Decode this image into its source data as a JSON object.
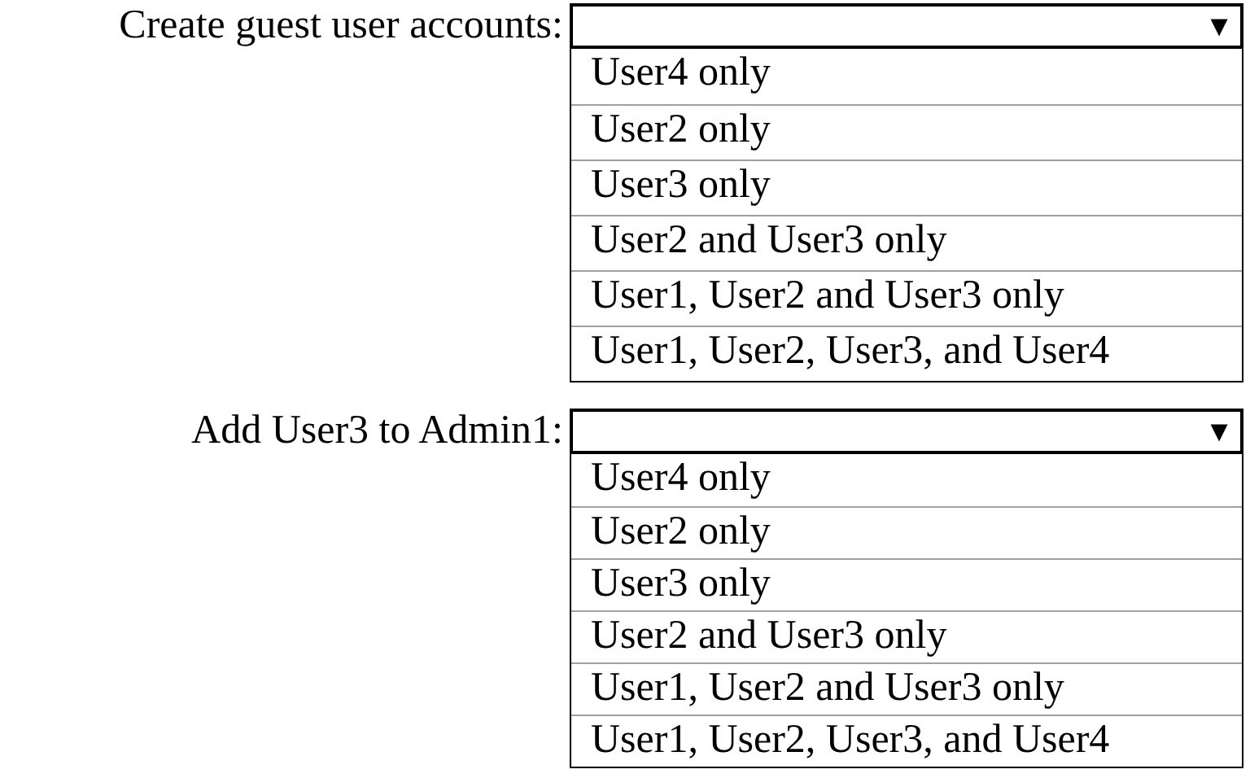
{
  "questions": [
    {
      "label": "Create guest user accounts:",
      "dropdown": {
        "arrow": "▼",
        "expanded": true,
        "options": [
          "User4 only",
          "User2 only",
          "User3 only",
          "User2 and User3 only",
          "User1, User2 and User3 only",
          "User1, User2, User3, and User4"
        ]
      }
    },
    {
      "label": "Add User3 to Admin1:",
      "dropdown": {
        "arrow": "▼",
        "expanded": true,
        "options": [
          "User4 only",
          "User2 only",
          "User3 only",
          "User2 and User3 only",
          "User1, User2 and User3 only",
          "User1, User2, User3, and User4"
        ]
      }
    }
  ]
}
